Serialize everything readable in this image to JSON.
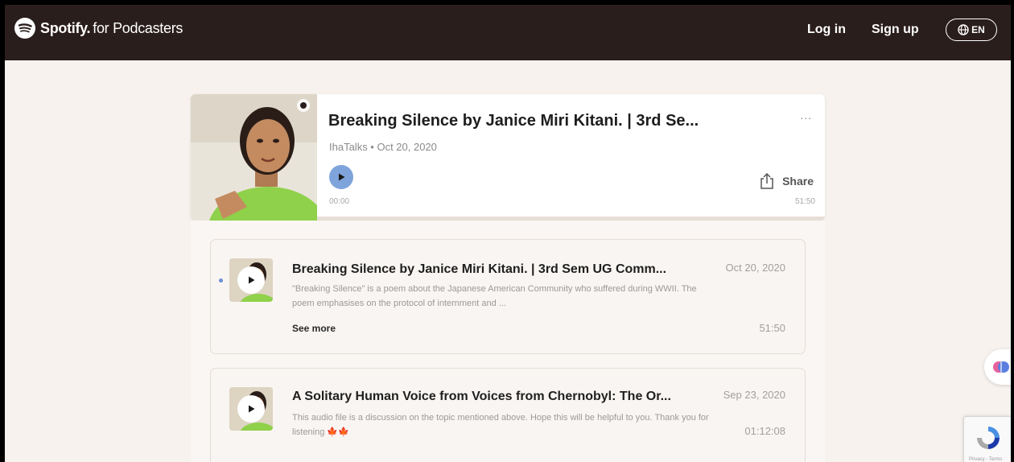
{
  "topbar": {
    "brand": "Spotify.",
    "brand_sub": "for Podcasters",
    "login_label": "Log in",
    "signup_label": "Sign up",
    "language_label": "EN"
  },
  "header": {
    "title": "Breaking Silence by Janice Miri Kitani. | 3rd Se...",
    "meta": "IhaTalks • Oct 20, 2020",
    "more_label": "...",
    "share_label": "Share",
    "time_current": "00:00",
    "time_total": "51:50",
    "progress_fraction": 0
  },
  "episodes": [
    {
      "title": "Breaking Silence by Janice Miri Kitani. | 3rd Sem UG Comm...",
      "description": "\"Breaking Silence\" is a poem about the Japanese American Community who suffered during WWII. The poem emphasises on the protocol of internment and ...",
      "date": "Oct 20, 2020",
      "duration": "51:50",
      "see_more_label": "See more"
    },
    {
      "title": "A Solitary Human Voice from Voices from Chernobyl: The Or...",
      "description": "This audio file is a discussion on the topic mentioned above. Hope this will be helpful to you. Thank you for listening 🍁🍁",
      "date": "Sep 23, 2020",
      "duration": "01:12:08"
    }
  ],
  "recaptcha": {
    "text": "Privacy - Terms"
  },
  "colors": {
    "topbar_bg": "#2a1e1c",
    "page_bg": "#f7f2ee",
    "play_accent": "#7fa4dc",
    "new_dot": "#6b8fd6"
  }
}
